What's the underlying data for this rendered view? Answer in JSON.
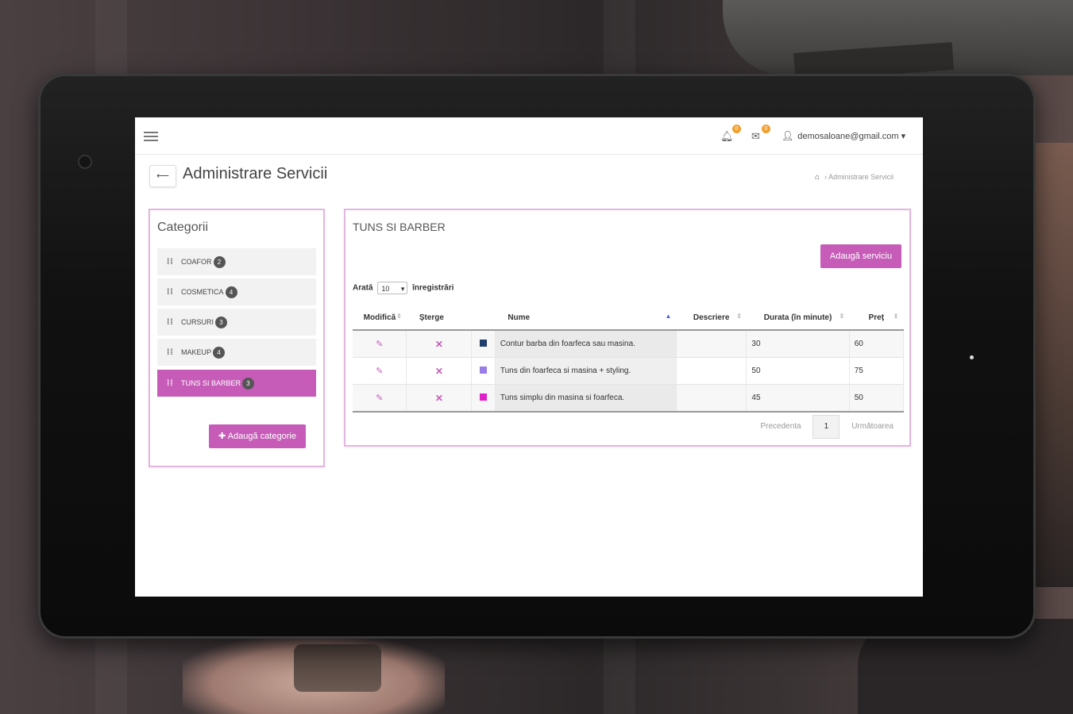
{
  "topbar": {
    "notifications_count": "0",
    "messages_count": "0",
    "user_email": "demosaloane@gmail.com",
    "user_caret": "▾"
  },
  "header": {
    "back_label": "⟵",
    "title": "Administrare Servicii",
    "breadcrumb_current": "Administrare Servicii"
  },
  "categories": {
    "title": "Categorii",
    "items": [
      {
        "label": "COAFOR",
        "count": "2"
      },
      {
        "label": "COSMETICA",
        "count": "4"
      },
      {
        "label": "CURSURI",
        "count": "3"
      },
      {
        "label": "MAKEUP",
        "count": "4"
      },
      {
        "label": "TUNS SI BARBER",
        "count": "3",
        "active": true
      }
    ],
    "add_label": "✚ Adaugă categorie"
  },
  "services": {
    "title": "TUNS SI BARBER",
    "add_label": "Adaugă serviciu",
    "length_prefix": "Arată",
    "length_value": "10",
    "length_suffix": "înregistrări",
    "columns": [
      "Modifică",
      "Șterge",
      "",
      "Nume",
      "Descriere",
      "Durata (în minute)",
      "Preț"
    ],
    "rows": [
      {
        "color": "#1f3f6e",
        "name": "Contur barba din foarfeca sau masina.",
        "description": "",
        "duration": "30",
        "price": "60"
      },
      {
        "color": "#9b7de8",
        "name": "Tuns din foarfeca si masina + styling.",
        "description": "",
        "duration": "50",
        "price": "75"
      },
      {
        "color": "#e020c8",
        "name": "Tuns simplu din masina si foarfeca.",
        "description": "",
        "duration": "45",
        "price": "50"
      }
    ],
    "pager": {
      "prev": "Precedenta",
      "page": "1",
      "next": "Următoarea"
    }
  },
  "colors": {
    "accent": "#c65cb8",
    "panel_border": "#e3b6de"
  }
}
